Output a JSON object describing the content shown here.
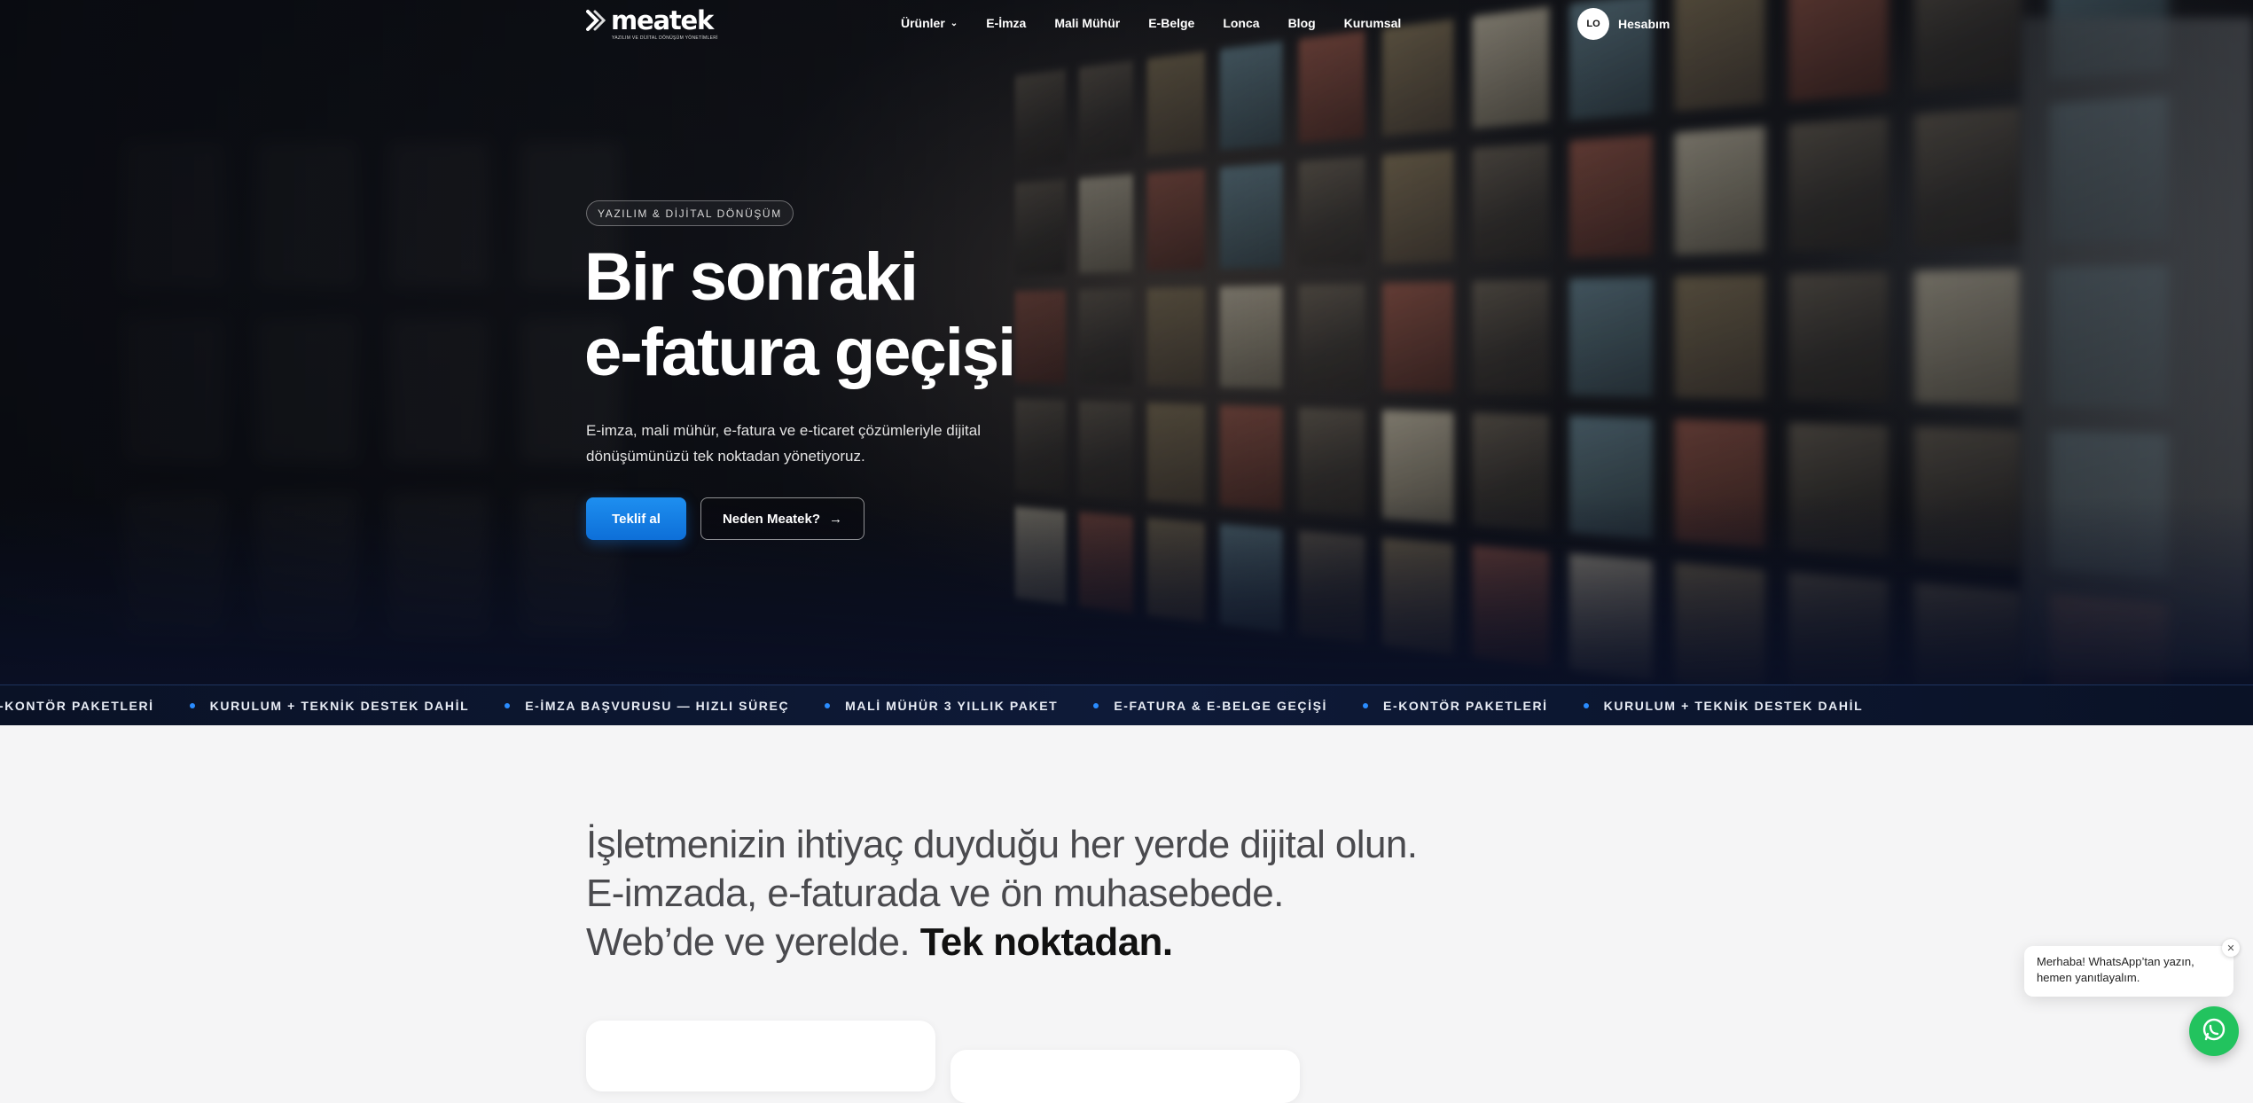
{
  "brand": {
    "name": "meatek",
    "tagline": "YAZILIM VE DİJİTAL DÖNÜŞÜM YÖNETİMLERİ"
  },
  "nav": {
    "items": [
      {
        "label": "Ürünler",
        "has_dropdown": true
      },
      {
        "label": "E-İmza"
      },
      {
        "label": "Mali Mühür"
      },
      {
        "label": "E-Belge"
      },
      {
        "label": "Lonca"
      },
      {
        "label": "Blog"
      },
      {
        "label": "Kurumsal"
      }
    ],
    "account_initials": "LO",
    "account_label": "Hesabım"
  },
  "hero": {
    "badge": "YAZILIM & DİJİTAL DÖNÜŞÜM",
    "title_line1": "Bir sonraki",
    "title_line2": "e-fatura geçişi",
    "subtitle": "E-imza, mali mühür, e-fatura ve e-ticaret çözümleriyle dijital dönüşümünüzü tek noktadan yönetiyoruz.",
    "primary_cta": "Teklif al",
    "secondary_cta": "Neden Meatek?"
  },
  "ticker": {
    "items": [
      "E-KONTÖR PAKETLERİ",
      "KURULUM + TEKNİK DESTEK DAHİL",
      "E-İMZA BAŞVURUSU — HIZLI SÜREÇ",
      "MALİ MÜHÜR 3 YILLIK PAKET",
      "E-FATURA & E-BELGE GEÇİŞİ",
      "E-KONTÖR PAKETLERİ",
      "KURULUM + TEKNİK DESTEK DAHİL"
    ]
  },
  "intro": {
    "text": "İşletmenizin ihtiyaç duyduğu her yerde dijital olun. E-imzada, e-faturada ve ön muhasebede. Web’de ve yerelde.",
    "strong": "Tek noktadan."
  },
  "whatsapp": {
    "message": "Merhaba! WhatsApp’tan yazın, hemen yanıtlayalım.",
    "accent": "#22C35E"
  },
  "colors": {
    "primary": "#0D6FD8",
    "ticker_dot": "#2A8CFF",
    "ticker_bg": "#0E1A38"
  }
}
